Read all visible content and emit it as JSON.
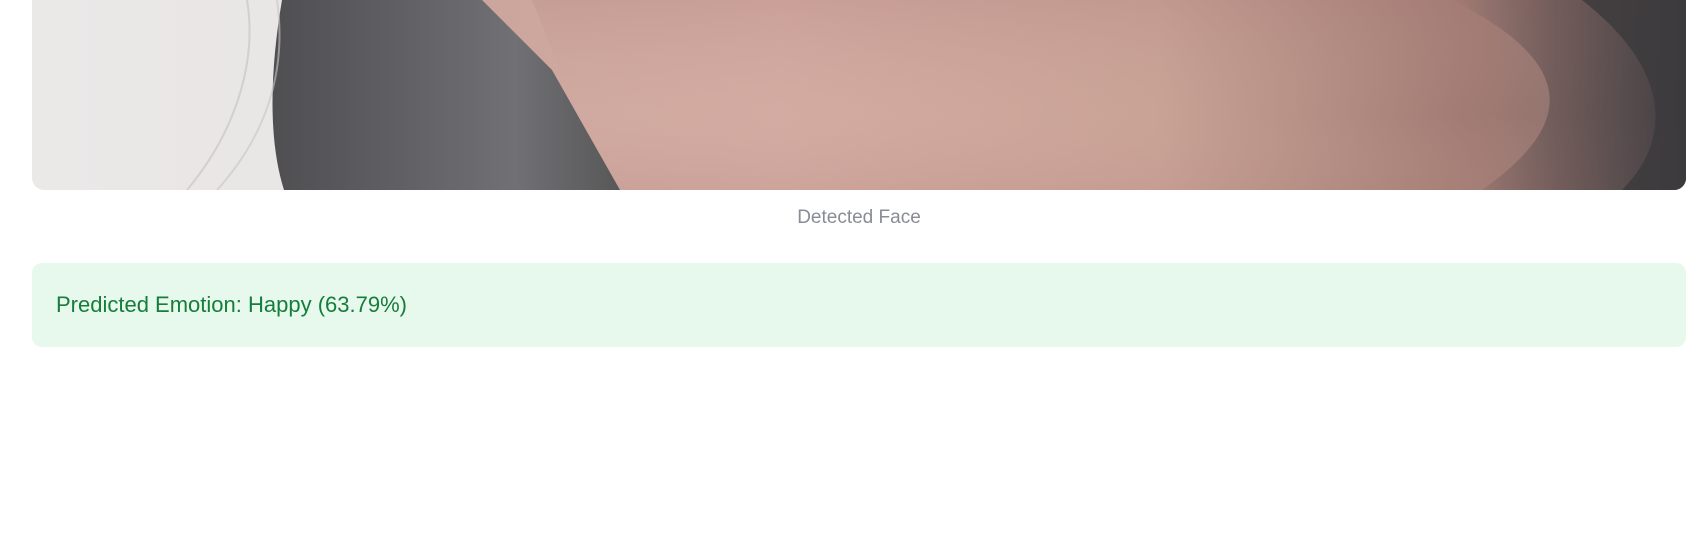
{
  "image": {
    "caption": "Detected Face"
  },
  "result": {
    "message": "Predicted Emotion: Happy (63.79%)"
  },
  "colors": {
    "caption_text": "#8a8c95",
    "success_background": "#e7f8ed",
    "success_text": "#177d3a"
  }
}
